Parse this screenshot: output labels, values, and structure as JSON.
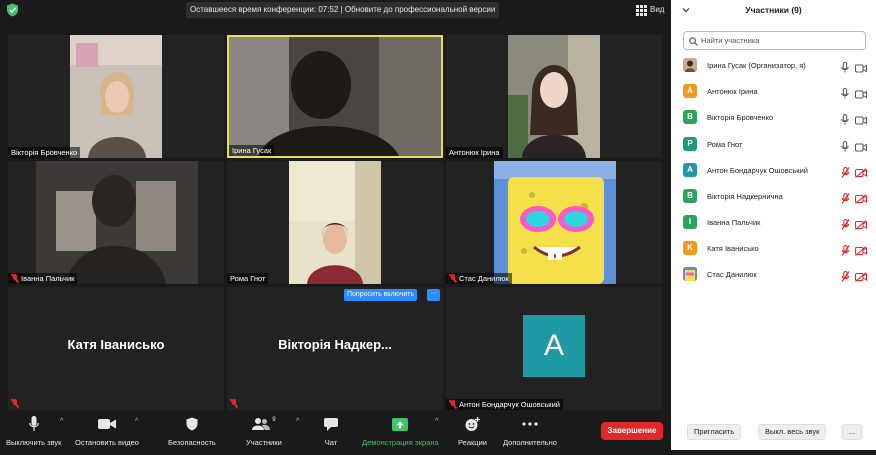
{
  "topbar": {
    "banner": "Оставшееся время конференции: 07:52 | Обновите до профессиональной версии",
    "view_label": "Вид"
  },
  "tiles": {
    "t1": {
      "name": "Вікторія Бровченко"
    },
    "t2": {
      "name": "Ірина Гусак"
    },
    "t3": {
      "name": "Антонюк Ірина"
    },
    "t4": {
      "name": "Іванна Пальчик"
    },
    "t5": {
      "name": "Рома Гнот"
    },
    "t6": {
      "name": "Стас Данилюк"
    },
    "t7": {
      "name": "Катя Іванисько"
    },
    "t8": {
      "name": "Вікторія Надкер..."
    },
    "t9": {
      "name": "Антон Бондарчук Ошовський",
      "avatar_letter": "A"
    }
  },
  "ask_unmute": {
    "label": "Попросить включить",
    "more": "···"
  },
  "toolbar": {
    "mute": "Выключить звук",
    "stop_video": "Остановить видео",
    "security": "Безопасность",
    "participants": "Участники",
    "participants_count": "9",
    "chat": "Чат",
    "share": "Демонстрация экрана",
    "reactions": "Реакции",
    "more": "Дополнительно",
    "end": "Завершение"
  },
  "panel": {
    "title": "Участники (9)",
    "search_placeholder": "Найти участника",
    "participants": [
      {
        "initial": "",
        "name": "Ірина Гусак (Организатор, я)",
        "color": "#c9a98f",
        "mic": "on",
        "video": "on"
      },
      {
        "initial": "A",
        "name": "Антонюк Ірина",
        "color": "#f29a1f",
        "mic": "on",
        "video": "on"
      },
      {
        "initial": "B",
        "name": "Вікторія Бровченко",
        "color": "#2ba35a",
        "mic": "on",
        "video": "on"
      },
      {
        "initial": "P",
        "name": "Рома Гнот",
        "color": "#1c9b7a",
        "mic": "on",
        "video": "on"
      },
      {
        "initial": "A",
        "name": "Антон Бондарчук Ошовський",
        "color": "#1f9aa5",
        "mic": "off",
        "video": "off"
      },
      {
        "initial": "B",
        "name": "Вікторія Надкернична",
        "color": "#2ba35a",
        "mic": "off",
        "video": "off"
      },
      {
        "initial": "I",
        "name": "Іванна Пальчик",
        "color": "#2ba35a",
        "mic": "off",
        "video": "off"
      },
      {
        "initial": "K",
        "name": "Катя Іванисько",
        "color": "#f29a1f",
        "mic": "off",
        "video": "off"
      },
      {
        "initial": "",
        "name": "Стас Данилюк",
        "color": "#3a6fd8",
        "mic": "off",
        "video": "off"
      }
    ],
    "invite": "Пригласить",
    "mute_all": "Выкл. весь звук",
    "more": "..."
  },
  "colors": {
    "accent": "#2d8cff",
    "active_speaker": "#e5de53",
    "danger": "#e02828",
    "share_green": "#3ec46d"
  }
}
